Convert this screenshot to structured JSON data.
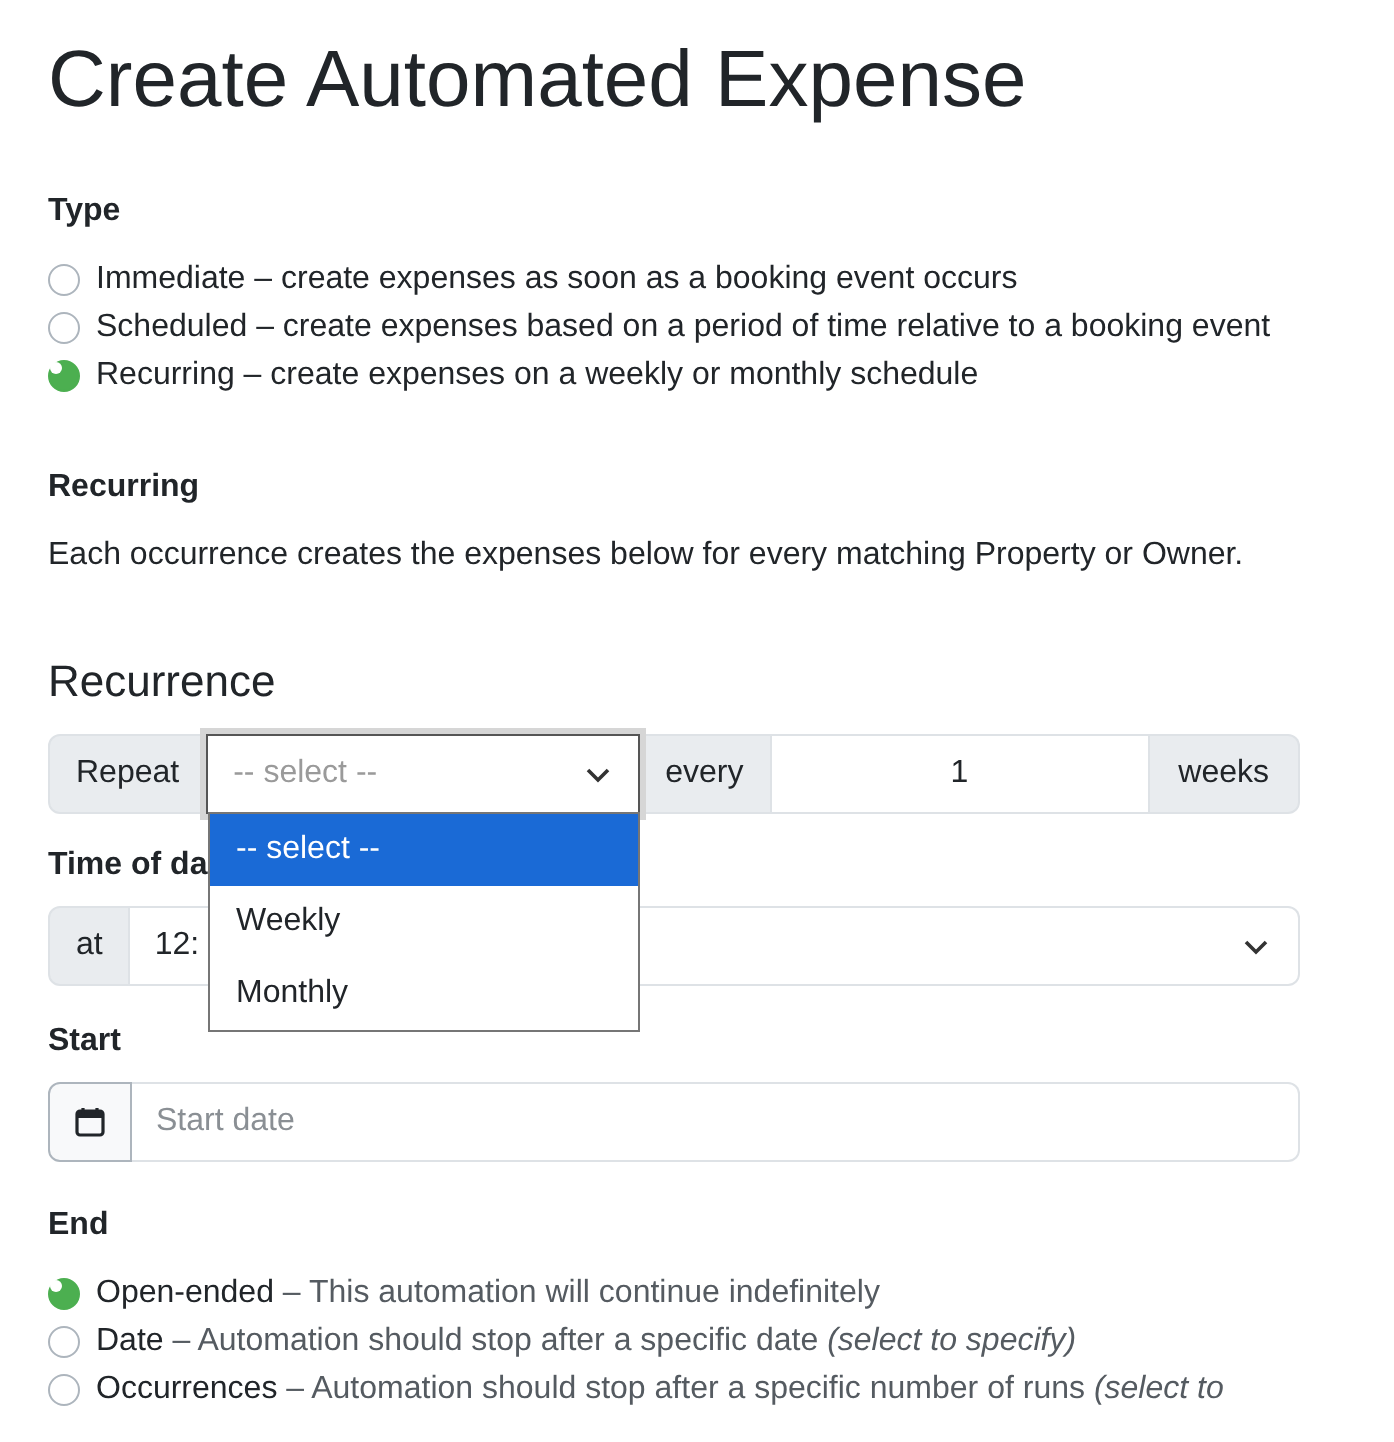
{
  "title": "Create Automated Expense",
  "type": {
    "heading": "Type",
    "options": [
      {
        "label": "Immediate – create expenses as soon as a booking event occurs",
        "selected": false
      },
      {
        "label": "Scheduled – create expenses based on a period of time relative to a booking event",
        "selected": false
      },
      {
        "label": "Recurring – create expenses on a weekly or monthly schedule",
        "selected": true
      }
    ]
  },
  "recurring": {
    "heading": "Recurring",
    "text": "Each occurrence creates the expenses below for every matching Property or Owner."
  },
  "recurrence": {
    "heading": "Recurrence",
    "repeat_label": "Repeat",
    "repeat_select": {
      "placeholder": "-- select --",
      "expanded": true,
      "options": [
        {
          "label": "-- select --",
          "selected": true
        },
        {
          "label": "Weekly",
          "selected": false
        },
        {
          "label": "Monthly",
          "selected": false
        }
      ]
    },
    "every_label": "every",
    "every_value": "1",
    "unit_label": "weeks"
  },
  "time_of_day": {
    "heading": "Time of da",
    "at_label": "at",
    "value": "12:"
  },
  "start": {
    "heading": "Start",
    "placeholder": "Start date"
  },
  "end": {
    "heading": "End",
    "options": [
      {
        "label": "Open-ended",
        "description": " – This automation will continue indefinitely",
        "selected": true
      },
      {
        "label": "Date",
        "description": " – Automation should stop after a specific date *(select to specify)*",
        "selected": false
      },
      {
        "label": "Occurrences",
        "description": " – Automation should stop after a specific number of runs *(select to*",
        "selected": false
      }
    ]
  }
}
